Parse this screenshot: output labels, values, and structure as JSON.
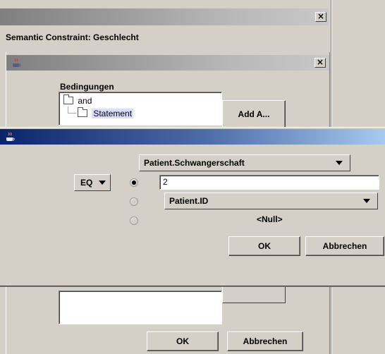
{
  "outer_window": {
    "title": "Semantic Constraint: Geschlecht",
    "close_glyph": "×"
  },
  "middle_window": {
    "close_glyph": "×",
    "section_label": "Bedingungen",
    "tree": [
      {
        "label": "and",
        "level": 0
      },
      {
        "label": "Statement",
        "level": 1,
        "selected": true
      }
    ],
    "add_button": "Add A...",
    "ok_button": "OK",
    "cancel_button": "Abbrechen"
  },
  "dialog": {
    "field_combo": "Patient.Schwangerschaft",
    "operator_combo": "EQ",
    "value_input": "2",
    "attribute_combo": "Patient.ID",
    "null_option": "<Null>",
    "selected_option": "value",
    "ok_button": "OK",
    "cancel_button": "Abbrechen"
  },
  "colors": {
    "panel": "#d4d0c8",
    "title_active_start": "#0a246a",
    "title_active_end": "#a6caf0",
    "title_inactive_start": "#808080",
    "selection_bg": "#dcdcff"
  }
}
